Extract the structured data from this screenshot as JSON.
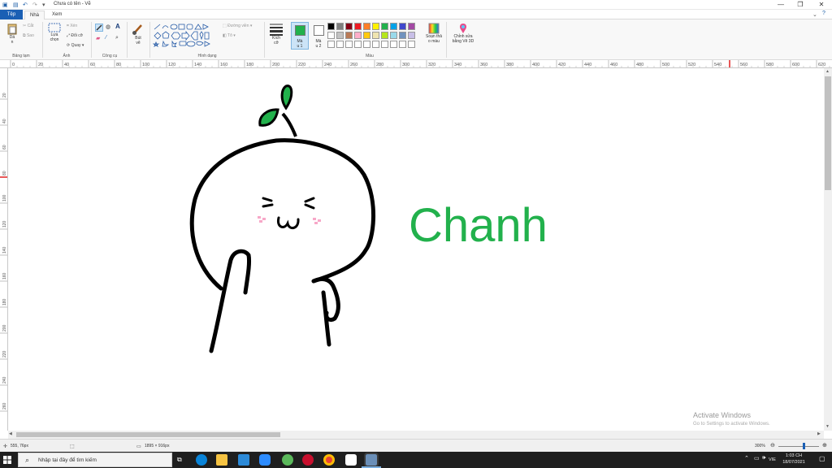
{
  "window": {
    "title": "Chưa có tên - Vẽ",
    "controls": {
      "minimize": "—",
      "maximize": "❐",
      "close": "✕"
    }
  },
  "tabs": [
    {
      "label": "Tệp"
    },
    {
      "label": "Nhà"
    },
    {
      "label": "Xem"
    }
  ],
  "ribbon": {
    "clipboard": {
      "paste": "Dá\nn",
      "cut": "Cắt",
      "copy": "Sao",
      "label": "Bảng tạm"
    },
    "image": {
      "select": "Lựa\nchọn",
      "crop": "Xén",
      "resize": "Đổi cỡ",
      "rotate": "Quay",
      "label": "Ảnh"
    },
    "tools": {
      "label": "Công cụ"
    },
    "brushes": {
      "label": "Bút\nvẽ"
    },
    "shapes": {
      "outline": "Đường viền",
      "fill": "Tô",
      "label": "Hình dạng"
    },
    "size": {
      "label": "Kích\ncỡ"
    },
    "color1": {
      "label": "Mà\nu 1",
      "value": "#22b14c"
    },
    "color2": {
      "label": "Mà\nu 2",
      "value": "#ffffff"
    },
    "colors_label": "Màu",
    "edit_colors": "Soạn thả\no màu",
    "paint3d": "Chỉnh sửa\nbằng Vẽ 3D",
    "palette_row1": [
      "#000000",
      "#7f7f7f",
      "#880015",
      "#ed1c24",
      "#ff7f27",
      "#fff200",
      "#22b14c",
      "#00a2e8",
      "#3f48cc",
      "#a349a4"
    ],
    "palette_row2": [
      "#ffffff",
      "#c3c3c3",
      "#b97a57",
      "#ffaec9",
      "#ffc90e",
      "#efe4b0",
      "#b5e61d",
      "#99d9ea",
      "#7092be",
      "#c8bfe7"
    ]
  },
  "ruler": {
    "h_ticks": [
      "0",
      "20",
      "40",
      "60",
      "80",
      "100",
      "120",
      "140",
      "160",
      "180",
      "200",
      "220",
      "240",
      "260",
      "280",
      "300",
      "320",
      "340",
      "360",
      "380",
      "400",
      "420",
      "440",
      "460",
      "480",
      "500",
      "520",
      "540",
      "560",
      "580",
      "600",
      "620"
    ],
    "v_ticks": [
      "20",
      "40",
      "60",
      "80",
      "100",
      "120",
      "140",
      "160",
      "180",
      "200",
      "220",
      "240",
      "260"
    ]
  },
  "drawing": {
    "text": "Chanh",
    "stroke_color": "#000000",
    "text_color": "#22b14c",
    "leaf_color": "#22b14c",
    "blush_color": "#f7a8c8"
  },
  "status": {
    "cursor_pos": "555, 76px",
    "canvas_size": "1895 × 916px",
    "zoom": "300%"
  },
  "watermark": {
    "line1": "Activate Windows",
    "line2": "Go to Settings to activate Windows."
  },
  "taskbar": {
    "search_placeholder": "Nhập tại đây để tìm kiếm",
    "lang": "VIE",
    "time": "1:03 CH",
    "date": "18/07/2021"
  }
}
